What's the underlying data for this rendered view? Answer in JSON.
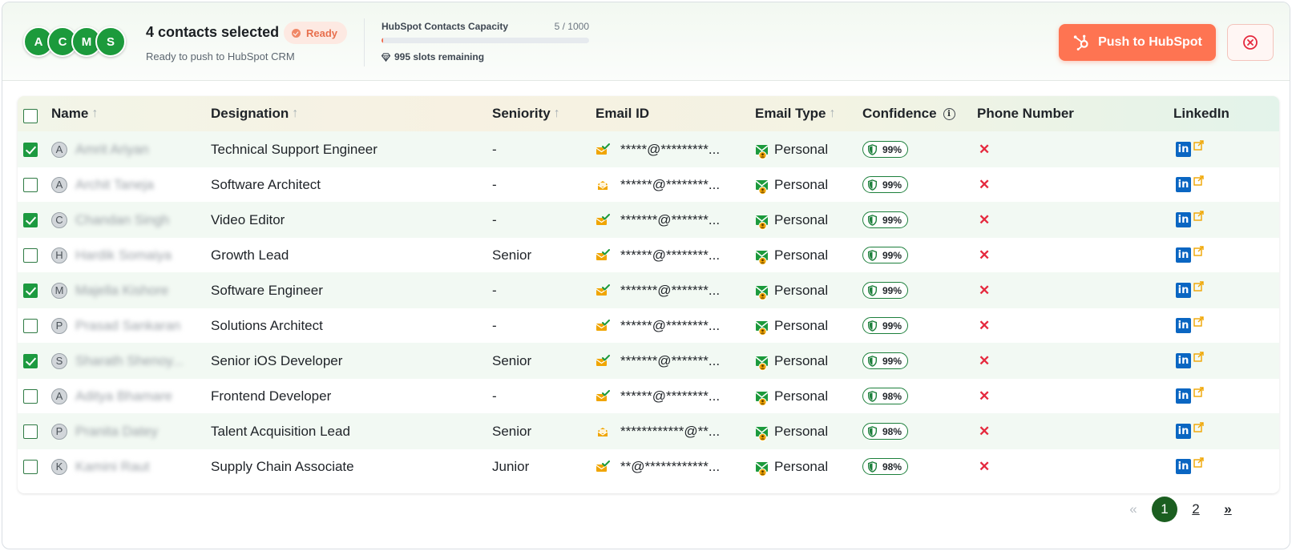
{
  "header": {
    "avatars": [
      "A",
      "C",
      "M",
      "S"
    ],
    "selected_title": "4 contacts selected",
    "status_badge": "Ready",
    "subtitle": "Ready to push to HubSpot CRM",
    "capacity_title": "HubSpot Contacts Capacity",
    "capacity_count": "5 / 1000",
    "capacity_used_fraction": 0.005,
    "slots_remaining": "995 slots remaining",
    "push_button": "Push to HubSpot"
  },
  "columns": {
    "name": "Name",
    "designation": "Designation",
    "seniority": "Seniority",
    "email": "Email ID",
    "email_type": "Email Type",
    "confidence": "Confidence",
    "phone": "Phone Number",
    "linkedin": "LinkedIn"
  },
  "rows": [
    {
      "checked": true,
      "initial": "A",
      "name": "Amrit Ariyan",
      "designation": "Technical Support Engineer",
      "seniority": "-",
      "email_verified": true,
      "email": "*****@*********...",
      "email_type": "Personal",
      "confidence": "99%"
    },
    {
      "checked": false,
      "initial": "A",
      "name": "Archit Taneja",
      "designation": "Software Architect",
      "seniority": "-",
      "email_verified": false,
      "email": "******@********...",
      "email_type": "Personal",
      "confidence": "99%"
    },
    {
      "checked": true,
      "initial": "C",
      "name": "Chandan Singh",
      "designation": "Video Editor",
      "seniority": "-",
      "email_verified": true,
      "email": "*******@*******...",
      "email_type": "Personal",
      "confidence": "99%"
    },
    {
      "checked": false,
      "initial": "H",
      "name": "Hardik Somaiya",
      "designation": "Growth Lead",
      "seniority": "Senior",
      "email_verified": true,
      "email": "******@********...",
      "email_type": "Personal",
      "confidence": "99%"
    },
    {
      "checked": true,
      "initial": "M",
      "name": "Majella Kishore",
      "designation": "Software Engineer",
      "seniority": "-",
      "email_verified": true,
      "email": "*******@*******...",
      "email_type": "Personal",
      "confidence": "99%"
    },
    {
      "checked": false,
      "initial": "P",
      "name": "Prasad Sankaran",
      "designation": "Solutions Architect",
      "seniority": "-",
      "email_verified": true,
      "email": "******@********...",
      "email_type": "Personal",
      "confidence": "99%"
    },
    {
      "checked": true,
      "initial": "S",
      "name": "Sharath Shenoy...",
      "designation": "Senior iOS Developer",
      "seniority": "Senior",
      "email_verified": true,
      "email": "*******@*******...",
      "email_type": "Personal",
      "confidence": "99%"
    },
    {
      "checked": false,
      "initial": "A",
      "name": "Aditya Bhamare",
      "designation": "Frontend Developer",
      "seniority": "-",
      "email_verified": true,
      "email": "******@********...",
      "email_type": "Personal",
      "confidence": "98%"
    },
    {
      "checked": false,
      "initial": "P",
      "name": "Pranita Datey",
      "designation": "Talent Acquisition Lead",
      "seniority": "Senior",
      "email_verified": false,
      "email": "************@**...",
      "email_type": "Personal",
      "confidence": "98%"
    },
    {
      "checked": false,
      "initial": "K",
      "name": "Kamini Raut",
      "designation": "Supply Chain Associate",
      "seniority": "Junior",
      "email_verified": true,
      "email": "**@************...",
      "email_type": "Personal",
      "confidence": "98%"
    }
  ],
  "pagination": {
    "prev": "«",
    "pages": [
      "1",
      "2"
    ],
    "current": "1",
    "next": "»"
  },
  "colors": {
    "brand_green": "#1c9a3c",
    "hubspot_orange": "#fe7452",
    "danger_red": "#e5293e",
    "linkedin_blue": "#0a66c2"
  }
}
